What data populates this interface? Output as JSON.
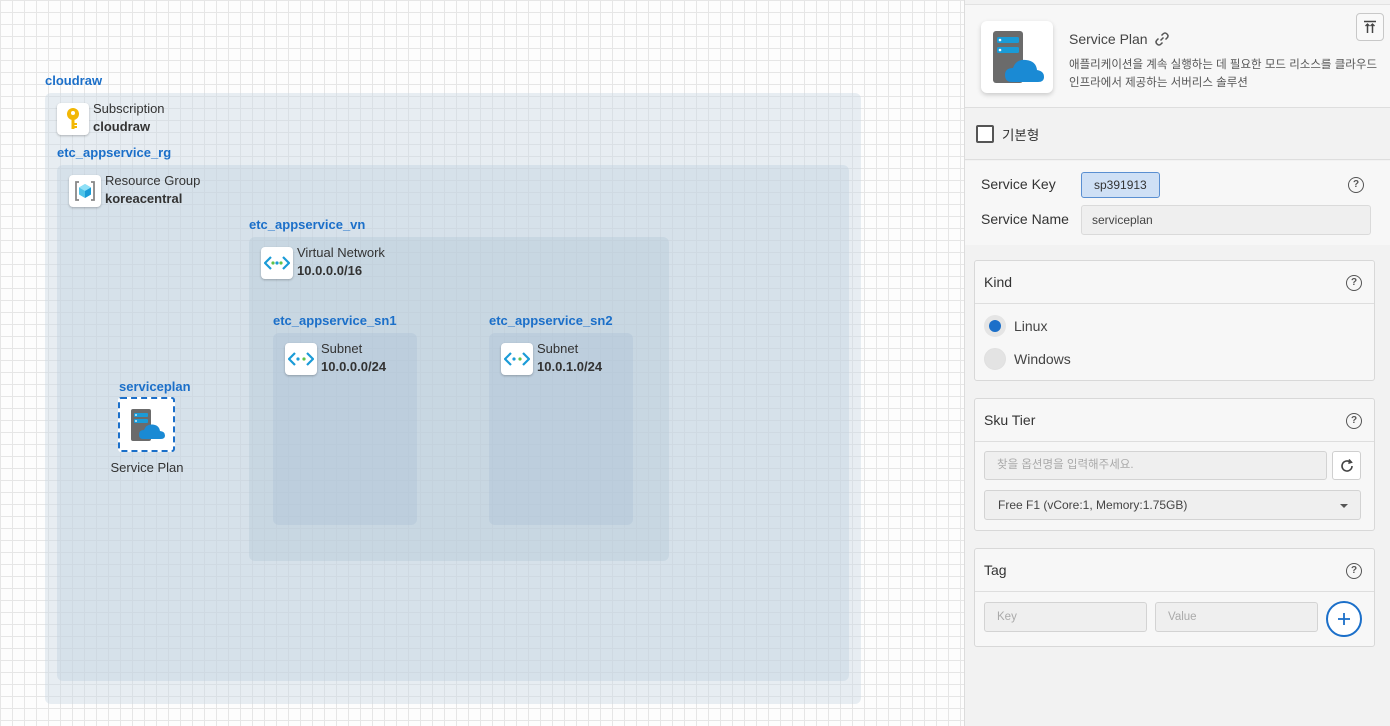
{
  "canvas": {
    "subscription": {
      "group_label": "cloudraw",
      "type": "Subscription",
      "value": "cloudraw"
    },
    "resource_group": {
      "group_label": "etc_appservice_rg",
      "type": "Resource Group",
      "value": "koreacentral"
    },
    "virtual_network": {
      "group_label": "etc_appservice_vn",
      "type": "Virtual Network",
      "value": "10.0.0.0/16"
    },
    "subnet1": {
      "group_label": "etc_appservice_sn1",
      "type": "Subnet",
      "value": "10.0.0.0/24"
    },
    "subnet2": {
      "group_label": "etc_appservice_sn2",
      "type": "Subnet",
      "value": "10.0.1.0/24"
    },
    "service_plan": {
      "label": "serviceplan",
      "caption": "Service Plan"
    }
  },
  "panel": {
    "header": {
      "title": "Service Plan",
      "description": "애플리케이션을 계속 실행하는 데 필요한 모드 리소스를 클라우드 인프라에서 제공하는 서버리스 솔루션"
    },
    "basic_checkbox": {
      "label": "기본형",
      "checked": false
    },
    "service_key": {
      "label": "Service Key",
      "value": "sp391913"
    },
    "service_name": {
      "label": "Service Name",
      "value": "serviceplan"
    },
    "kind": {
      "title": "Kind",
      "options": [
        {
          "label": "Linux",
          "selected": true
        },
        {
          "label": "Windows",
          "selected": false
        }
      ]
    },
    "sku_tier": {
      "title": "Sku Tier",
      "search_placeholder": "찾을 옵션명을 입력해주세요.",
      "selected": "Free F1 (vCore:1, Memory:1.75GB)"
    },
    "tag": {
      "title": "Tag",
      "key_placeholder": "Key",
      "value_placeholder": "Value"
    }
  },
  "colors": {
    "accent": "#1b6fc9",
    "key_badge_bg": "#cfe0f5"
  }
}
